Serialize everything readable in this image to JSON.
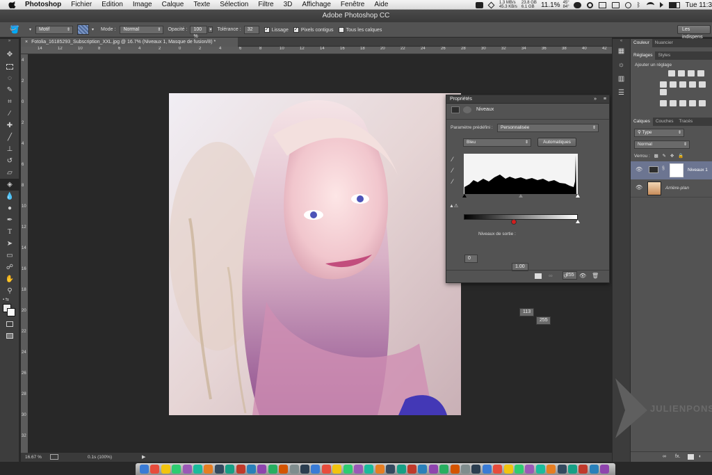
{
  "menubar": {
    "app_name": "Photoshop",
    "items": [
      "Fichier",
      "Edition",
      "Image",
      "Calque",
      "Texte",
      "Sélection",
      "Filtre",
      "3D",
      "Affichage",
      "Fenêtre",
      "Aide"
    ],
    "net_up": "1.3 MB/s",
    "net_down": "45.3 KB/s",
    "disk_u": "23.8 GB",
    "disk_f": "6.1 GB",
    "cpu": "11.1%",
    "temp": "45°",
    "temp2": "84°",
    "clock": "Tue 11:3"
  },
  "window": {
    "title": "Adobe Photoshop CC"
  },
  "options": {
    "fill_source": "Motif",
    "mode_label": "Mode :",
    "mode_value": "Normal",
    "opacity_label": "Opacité :",
    "opacity_value": "100 %",
    "tolerance_label": "Tolérance :",
    "tolerance_value": "32",
    "lissage": "Lissage",
    "contigus": "Pixels contigus",
    "tous_calques": "Tous les calques",
    "workspace": "Les indispens"
  },
  "document": {
    "tab_title": "Fotolia_16185293_Subscription_XXL.jpg @ 16.7% (Niveaux 1, Masque de fusion/8) *",
    "ruler_h": [
      "14",
      "12",
      "10",
      "8",
      "6",
      "4",
      "2",
      "0",
      "2",
      "4",
      "6",
      "8",
      "10",
      "12",
      "14",
      "16",
      "18",
      "20",
      "22",
      "24",
      "26",
      "28",
      "30",
      "32",
      "34",
      "36",
      "38",
      "40",
      "42"
    ],
    "ruler_v": [
      "4",
      "2",
      "0",
      "2",
      "4",
      "6",
      "8",
      "10",
      "12",
      "14",
      "16",
      "18",
      "20",
      "22",
      "24",
      "26",
      "28",
      "30",
      "32"
    ]
  },
  "status": {
    "zoom": "16.67 %",
    "timing": "0.1s (100%)"
  },
  "properties": {
    "title": "Propriétés",
    "adjustment": "Niveaux",
    "preset_label": "Paramètre prédéfini :",
    "preset_value": "Personnalisée",
    "channel": "Bleu",
    "auto_button": "Automatiques",
    "input_black": "0",
    "input_gamma": "1.00",
    "input_white": "255",
    "output_label": "Niveaux de sortie :",
    "output_black": "113",
    "output_white": "255"
  },
  "right_panel": {
    "tabs_top": [
      "Couleur",
      "Nuancier"
    ],
    "tabs_adj": [
      "Réglages",
      "Styles"
    ],
    "add_adjustment": "Ajouter un réglage",
    "tabs_layers": [
      "Calques",
      "Couches",
      "Tracés"
    ],
    "filter_kind": "Type",
    "blend_mode": "Normal",
    "lock_label": "Verrou :",
    "layers": [
      {
        "name": "Niveaux 1"
      },
      {
        "name": "Arrière-plan"
      }
    ]
  },
  "watermark": "JULIENPONS"
}
